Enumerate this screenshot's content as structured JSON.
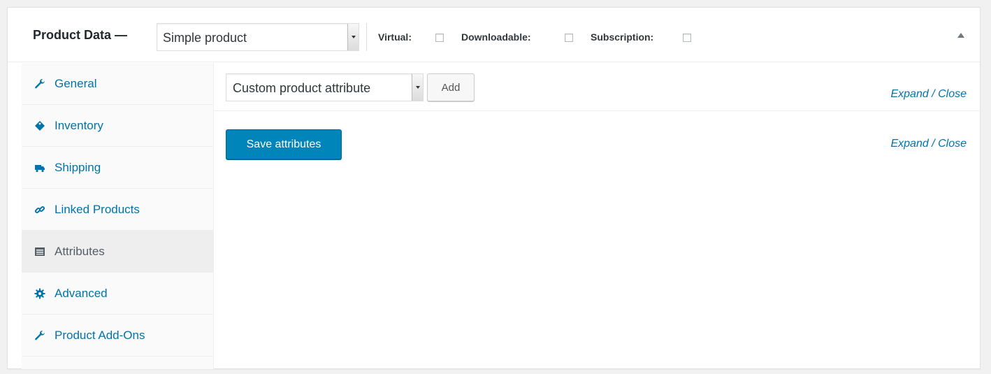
{
  "header": {
    "title": "Product Data —",
    "product_type": "Simple product",
    "options": [
      {
        "label": "Virtual:",
        "checked": false
      },
      {
        "label": "Downloadable:",
        "checked": false
      },
      {
        "label": "Subscription:",
        "checked": false
      }
    ]
  },
  "sidebar": {
    "items": [
      {
        "label": "General",
        "icon": "wrench-icon",
        "active": false
      },
      {
        "label": "Inventory",
        "icon": "tag-icon",
        "active": false
      },
      {
        "label": "Shipping",
        "icon": "truck-icon",
        "active": false
      },
      {
        "label": "Linked Products",
        "icon": "link-icon",
        "active": false
      },
      {
        "label": "Attributes",
        "icon": "list-icon",
        "active": true
      },
      {
        "label": "Advanced",
        "icon": "gear-icon",
        "active": false
      },
      {
        "label": "Product Add-Ons",
        "icon": "wrench-icon",
        "active": false
      }
    ]
  },
  "attributes": {
    "select_value": "Custom product attribute",
    "add_label": "Add",
    "expand_close_label": "Expand / Close",
    "expand_close_label_2": "Expand / Close",
    "save_label": "Save attributes"
  },
  "colors": {
    "link": "#0073aa",
    "primary_button": "#0085ba",
    "active_tab_bg": "#eeeeee",
    "sidebar_bg": "#fafafa"
  }
}
